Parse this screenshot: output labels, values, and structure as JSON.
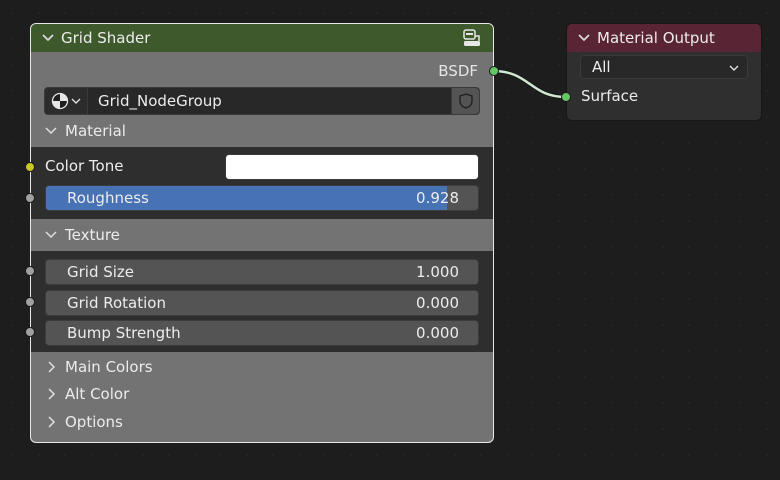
{
  "grid_node": {
    "title": "Grid Shader",
    "output_socket": "BSDF",
    "node_group": "Grid_NodeGroup",
    "panels": {
      "material": "Material",
      "texture": "Texture",
      "main_colors": "Main Colors",
      "alt_color": "Alt Color",
      "options": "Options"
    },
    "inputs": {
      "color_tone": {
        "label": "Color Tone",
        "color": "#ffffff"
      },
      "roughness": {
        "label": "Roughness",
        "value": "0.928",
        "fill_fraction": 0.928
      },
      "grid_size": {
        "label": "Grid Size",
        "value": "1.000"
      },
      "grid_rotation": {
        "label": "Grid Rotation",
        "value": "0.000"
      },
      "bump_strength": {
        "label": "Bump Strength",
        "value": "0.000"
      }
    }
  },
  "output_node": {
    "title": "Material Output",
    "target": "All",
    "input_socket": "Surface"
  },
  "colors": {
    "shader_header": "#3e5a2c",
    "output_header": "#592434",
    "link": "#cfe8cf",
    "roughness_fill": "#4772b3"
  },
  "icons": [
    "chevron-down-icon",
    "node-group-icon",
    "material-sphere-icon",
    "shield-icon",
    "chevron-right-icon"
  ]
}
